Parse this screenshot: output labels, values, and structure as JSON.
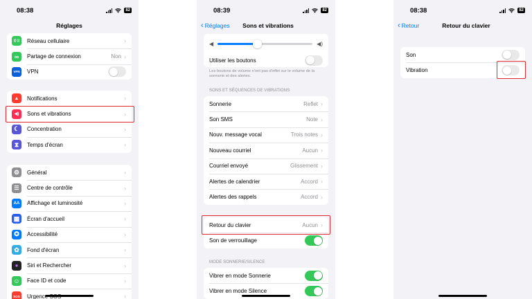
{
  "status": {
    "time1": "08:38",
    "time2": "08:39",
    "time3": "08:38",
    "battery": "82"
  },
  "colors": {
    "accent": "#007aff",
    "toggle_on": "#34c759",
    "highlight": "#e0282e"
  },
  "screen1": {
    "title": "Réglages",
    "group1": [
      {
        "label": "Réseau cellulaire",
        "icon": "antenna-icon",
        "icon_color": "#34c759",
        "icon_glyph": "((·))"
      },
      {
        "label": "Partage de connexion",
        "value": "Non",
        "icon": "link-icon",
        "icon_color": "#34c759",
        "icon_glyph": "∞"
      },
      {
        "label": "VPN",
        "icon": "vpn-icon",
        "icon_color": "#0a60d8",
        "icon_glyph": "VPN",
        "toggle": "off"
      }
    ],
    "group2": [
      {
        "label": "Notifications",
        "icon": "bell-icon",
        "icon_color": "#ff3b30",
        "icon_glyph": "▲"
      },
      {
        "label": "Sons et vibrations",
        "icon": "speaker-icon",
        "icon_color": "#ff2d55",
        "icon_glyph": "◀)"
      },
      {
        "label": "Concentration",
        "icon": "moon-icon",
        "icon_color": "#5856d6",
        "icon_glyph": "☾"
      },
      {
        "label": "Temps d'écran",
        "icon": "hourglass-icon",
        "icon_color": "#5856d6",
        "icon_glyph": "⧗"
      }
    ],
    "group3": [
      {
        "label": "Général",
        "icon": "gear-icon",
        "icon_color": "#8e8e93",
        "icon_glyph": "⚙"
      },
      {
        "label": "Centre de contrôle",
        "icon": "switches-icon",
        "icon_color": "#8e8e93",
        "icon_glyph": "☰"
      },
      {
        "label": "Affichage et luminosité",
        "icon": "text-size-icon",
        "icon_color": "#007aff",
        "icon_glyph": "AA"
      },
      {
        "label": "Écran d'accueil",
        "icon": "grid-icon",
        "icon_color": "#2c5ee8",
        "icon_glyph": "▦"
      },
      {
        "label": "Accessibilité",
        "icon": "accessibility-icon",
        "icon_color": "#007aff",
        "icon_glyph": "✪"
      },
      {
        "label": "Fond d'écran",
        "icon": "flower-icon",
        "icon_color": "#32ade6",
        "icon_glyph": "✿"
      },
      {
        "label": "Siri et Rechercher",
        "icon": "siri-icon",
        "icon_color": "#222222",
        "icon_glyph": "●"
      },
      {
        "label": "Face ID et code",
        "icon": "face-id-icon",
        "icon_color": "#34c759",
        "icon_glyph": "☺"
      },
      {
        "label": "Urgence SOS",
        "icon": "sos-icon",
        "icon_color": "#ff3b30",
        "icon_glyph": "SOS"
      }
    ]
  },
  "screen2": {
    "back": "Réglages",
    "title": "Sons et vibrations",
    "volume_level": 0.42,
    "use_buttons_label": "Utiliser les boutons",
    "use_buttons_note": "Les boutons de volume n'ont pas d'effet sur le volume de la sonnerie et des alertes.",
    "section_sounds": "SONS ET SÉQUENCES DE VIBRATIONS",
    "sounds": [
      {
        "label": "Sonnerie",
        "value": "Reflet"
      },
      {
        "label": "Son SMS",
        "value": "Note"
      },
      {
        "label": "Nouv. message vocal",
        "value": "Trois notes"
      },
      {
        "label": "Nouveau courriel",
        "value": "Aucun"
      },
      {
        "label": "Courriel envoyé",
        "value": "Glissement"
      },
      {
        "label": "Alertes de calendrier",
        "value": "Accord"
      },
      {
        "label": "Alertes des rappels",
        "value": "Accord"
      }
    ],
    "keyboard_label": "Retour du clavier",
    "keyboard_value": "Aucun",
    "lock_label": "Son de verrouillage",
    "section_mode": "MODE SONNERIE/SILENCE",
    "vibrate_ring_label": "Vibrer en mode Sonnerie",
    "vibrate_silent_label": "Vibrer en mode Silence"
  },
  "screen3": {
    "back": "Retour",
    "title": "Retour du clavier",
    "sound_label": "Son",
    "vibration_label": "Vibration"
  }
}
